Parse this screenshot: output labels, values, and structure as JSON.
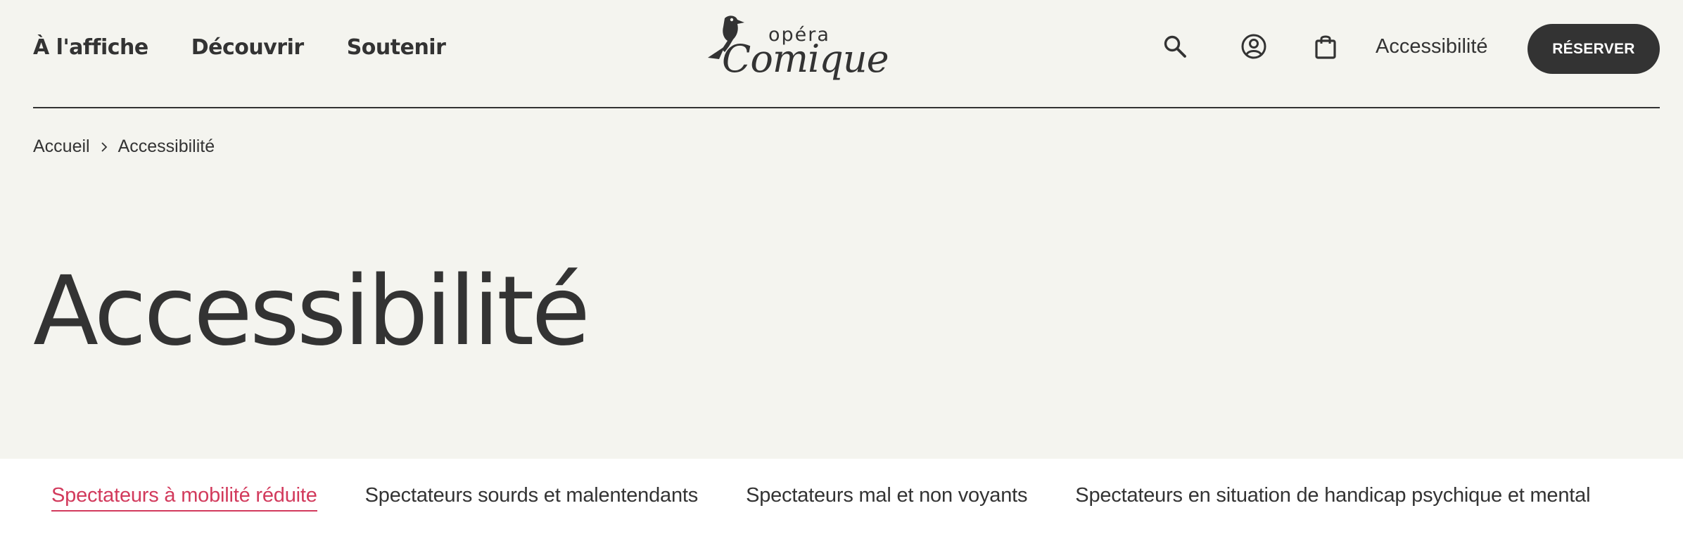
{
  "header": {
    "nav": [
      {
        "label": "À l'affiche"
      },
      {
        "label": "Découvrir"
      },
      {
        "label": "Soutenir"
      }
    ],
    "logo": {
      "top": "opéra",
      "bottom": "Comique"
    },
    "icons": {
      "search": "search-icon",
      "account": "user-circle-icon",
      "cart": "shopping-bag-icon"
    },
    "accessibility_link": "Accessibilité",
    "reserve_button": "RÉSERVER"
  },
  "breadcrumb": {
    "home": "Accueil",
    "separator_icon": "chevron-right-icon",
    "current": "Accessibilité"
  },
  "page": {
    "title": "Accessibilité"
  },
  "tabs": [
    {
      "label": "Spectateurs à mobilité réduite",
      "active": true
    },
    {
      "label": "Spectateurs sourds et malentendants",
      "active": false
    },
    {
      "label": "Spectateurs mal et non voyants",
      "active": false
    },
    {
      "label": "Spectateurs en situation de handicap psychique et mental",
      "active": false
    }
  ],
  "colors": {
    "text": "#333333",
    "hero_background": "#f4f4ef",
    "accent": "#d23a5c",
    "button": "#333333"
  }
}
